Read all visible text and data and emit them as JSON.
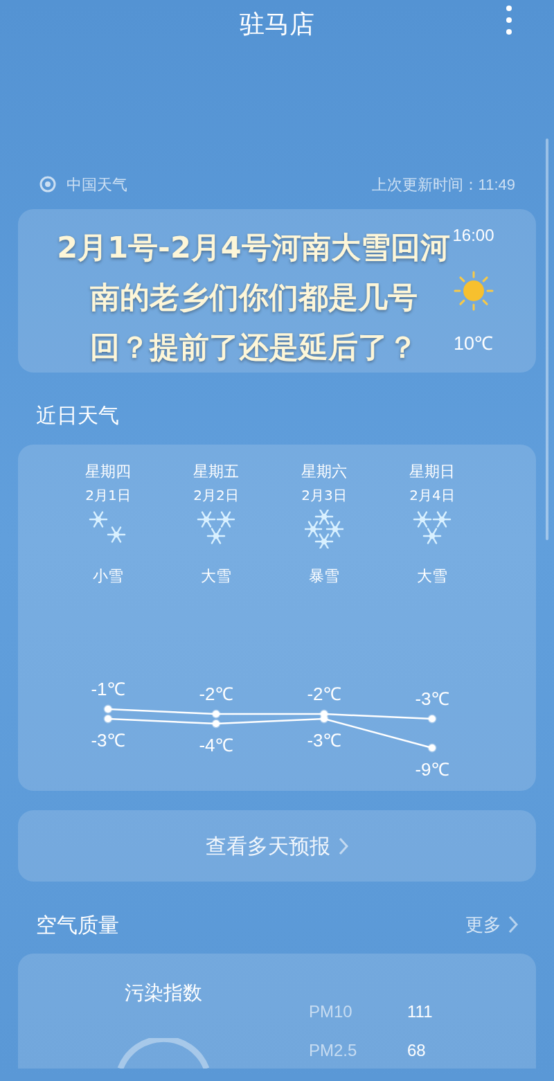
{
  "header": {
    "title": "驻马店"
  },
  "source": {
    "name": "中国天气",
    "updated": "上次更新时间：11:49"
  },
  "hourly": [
    {
      "kind": "sunny",
      "time": "16:00",
      "temp": "10℃"
    }
  ],
  "caption": [
    "2月1号-2月4号河南大雪回河",
    "南的老乡们你们都是几号",
    "回？提前了还是延后了？"
  ],
  "daily_title": "近日天气",
  "days": [
    {
      "weekday": "星期四",
      "date": "2月1日",
      "kind": "light_snow",
      "weather": "小雪"
    },
    {
      "weekday": "星期五",
      "date": "2月2日",
      "kind": "heavy_snow",
      "weather": "大雪"
    },
    {
      "weekday": "星期六",
      "date": "2月3日",
      "kind": "blizzard",
      "weather": "暴雪"
    },
    {
      "weekday": "星期日",
      "date": "2月4日",
      "kind": "heavy_snow",
      "weather": "大雪"
    }
  ],
  "chart_data": {
    "type": "line",
    "series": [
      {
        "color": "#ffffff",
        "marker": "circle",
        "values": [
          -1,
          -2,
          -2,
          -3
        ],
        "value_labels": [
          "-1℃",
          "-2℃",
          "-2℃",
          "-3℃"
        ]
      },
      {
        "color": "#ffffff",
        "marker": "circle",
        "values": [
          -3,
          -4,
          -3,
          -9
        ],
        "value_labels": [
          "-3℃",
          "-4℃",
          "-3℃",
          "-9℃"
        ]
      }
    ]
  },
  "more_days_button": "查看多天预报",
  "air": {
    "title": "空气质量",
    "more": "更多",
    "index_label": "污染指数",
    "pollutants": [
      {
        "name": "PM10",
        "value": "111"
      },
      {
        "name": "PM2.5",
        "value": "68"
      }
    ]
  }
}
